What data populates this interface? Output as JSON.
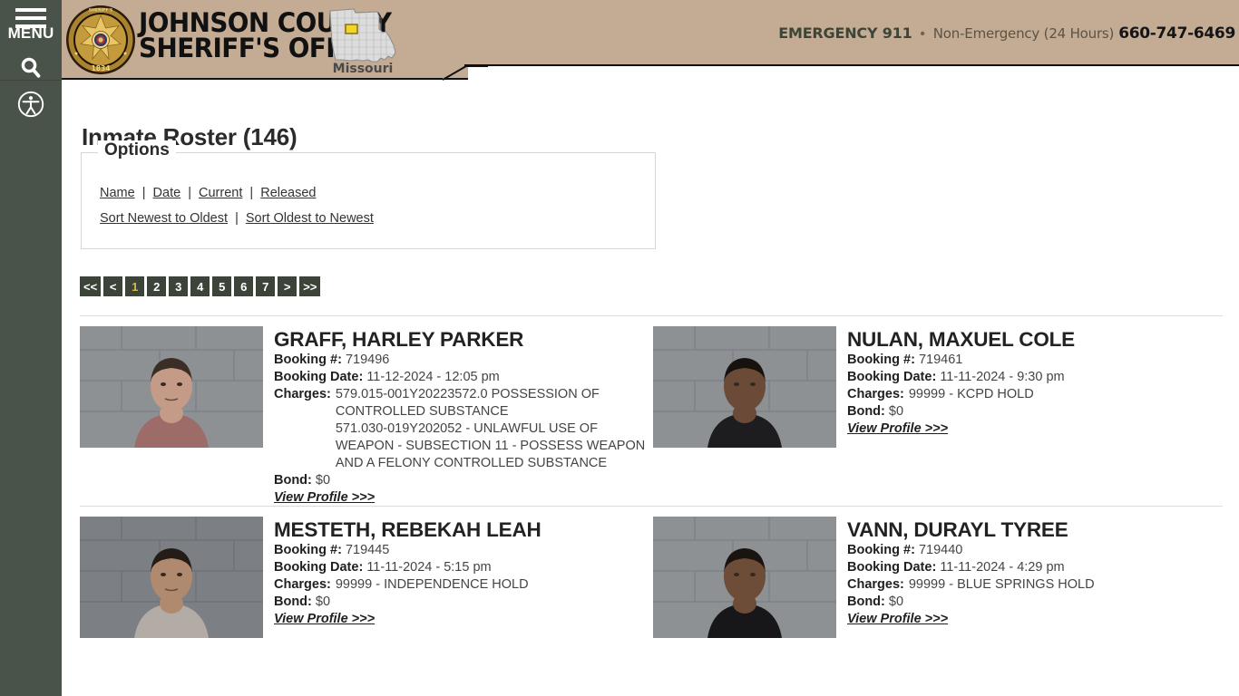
{
  "sidebar": {
    "menu_label": "MENU",
    "icons": [
      {
        "name": "hamburger-icon",
        "label": "MENU"
      },
      {
        "name": "search-icon",
        "label": "Search"
      },
      {
        "name": "accessibility-icon",
        "label": "Accessibility"
      }
    ]
  },
  "header": {
    "badge_alt": "Johnson County Sheriff's Office badge",
    "badge_text_top": "JOHNSON COUNTY SHERIFF'S OFFICE",
    "badge_year": "1834",
    "org_line1": "JOHNSON COUNTY",
    "org_line2": "SHERIFF'S OFFICE",
    "state_label": "Missouri",
    "emergency_label": "EMERGENCY 911",
    "separator_dot": "•",
    "nonemergency_label": "Non-Emergency (24 Hours)",
    "nonemergency_number": "660-747-6469",
    "colors": {
      "header_bg": "#c4ab93",
      "sidebar_bg": "#4a5349",
      "accent_gold": "#d4b84a"
    }
  },
  "main": {
    "page_title": "Inmate Roster (146)",
    "options": {
      "legend": "Options",
      "row1": [
        {
          "label": "Name"
        },
        {
          "label": "Date"
        },
        {
          "label": "Current"
        },
        {
          "label": "Released"
        }
      ],
      "row2": [
        {
          "label": "Sort Newest to Oldest"
        },
        {
          "label": "Sort Oldest to Newest"
        }
      ],
      "separator": "|"
    },
    "pagination": {
      "items": [
        {
          "label": "<<",
          "active": false
        },
        {
          "label": "<",
          "active": false
        },
        {
          "label": "1",
          "active": true
        },
        {
          "label": "2",
          "active": false
        },
        {
          "label": "3",
          "active": false
        },
        {
          "label": "4",
          "active": false
        },
        {
          "label": "5",
          "active": false
        },
        {
          "label": "6",
          "active": false
        },
        {
          "label": "7",
          "active": false
        },
        {
          "label": ">",
          "active": false
        },
        {
          "label": ">>",
          "active": false
        }
      ]
    },
    "labels": {
      "booking_number": "Booking #:",
      "booking_date": "Booking Date:",
      "charges": "Charges:",
      "bond": "Bond:",
      "view_profile": "View Profile >>>"
    },
    "inmates": [
      {
        "name": "GRAFF, HARLEY PARKER",
        "booking_number": "719496",
        "booking_date": "11-12-2024 - 12:05 pm",
        "charges": [
          "579.015-001Y20223572.0 POSSESSION OF CONTROLLED SUBSTANCE",
          "571.030-019Y202052 - UNLAWFUL USE OF WEAPON - SUBSECTION 11 - POSSESS WEAPON AND A FELONY CONTROLLED SUBSTANCE"
        ],
        "bond": "$0",
        "mugshot": {
          "skin": "#c49b86",
          "hair": "#3a2e26",
          "shirt": "#9d6b68",
          "wall": "#8e9194"
        }
      },
      {
        "name": "NULAN, MAXUEL COLE",
        "booking_number": "719461",
        "booking_date": "11-11-2024 - 9:30 pm",
        "charges": [
          "99999 - KCPD HOLD"
        ],
        "bond": "$0",
        "mugshot": {
          "skin": "#6b4a38",
          "hair": "#18120e",
          "shirt": "#1d1d20",
          "wall": "#8e9194"
        }
      },
      {
        "name": "MESTETH, REBEKAH LEAH",
        "booking_number": "719445",
        "booking_date": "11-11-2024 - 5:15 pm",
        "charges": [
          "99999 - INDEPENDENCE HOLD"
        ],
        "bond": "$0",
        "mugshot": {
          "skin": "#b08a6e",
          "hair": "#241c16",
          "shirt": "#b3aca6",
          "wall": "#7c8084"
        }
      },
      {
        "name": "VANN, DURAYL TYREE",
        "booking_number": "719440",
        "booking_date": "11-11-2024 - 4:29 pm",
        "charges": [
          "99999 - BLUE SPRINGS HOLD"
        ],
        "bond": "$0",
        "mugshot": {
          "skin": "#6d4c38",
          "hair": "#1a1410",
          "shirt": "#17171a",
          "wall": "#8e9194"
        }
      }
    ]
  }
}
